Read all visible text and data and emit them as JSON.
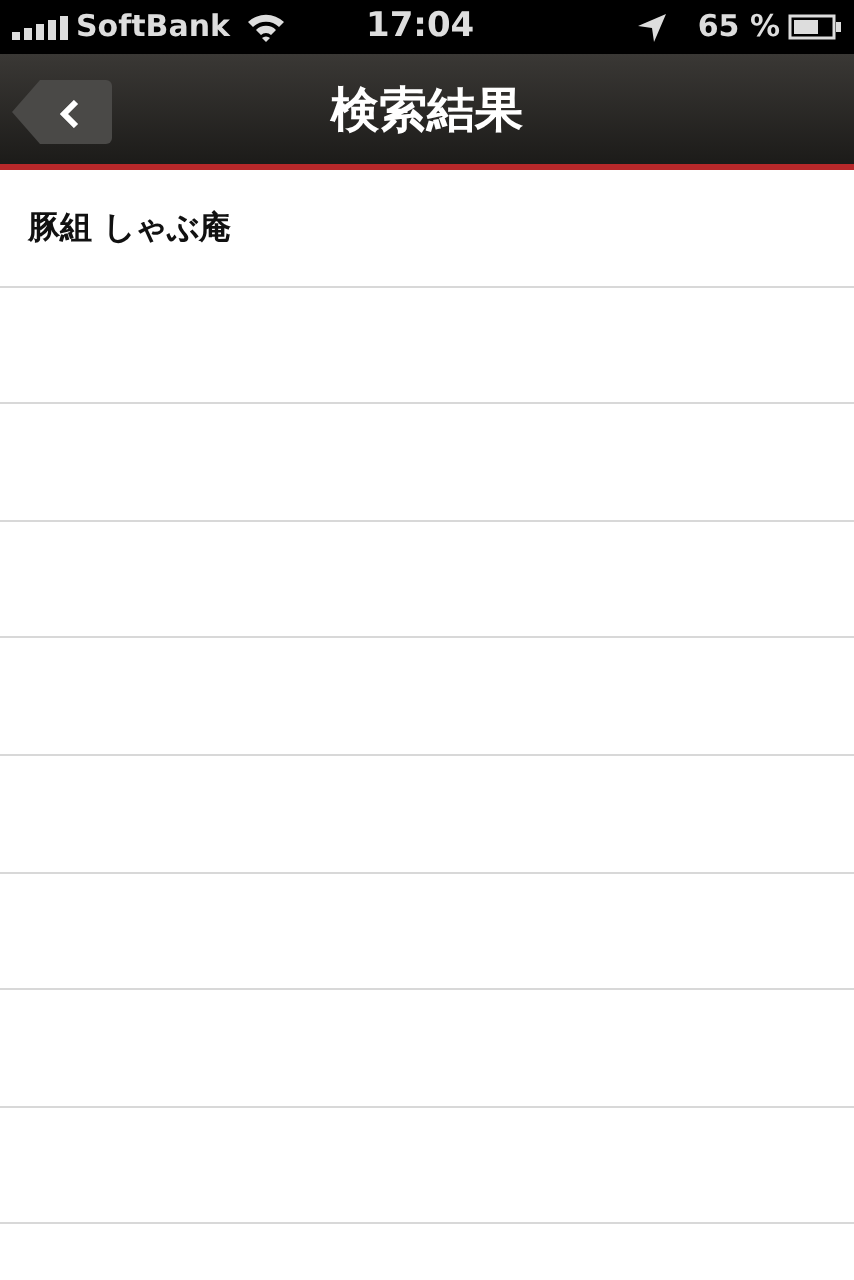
{
  "status_bar": {
    "carrier": "SoftBank",
    "time": "17:04",
    "battery": "65 %"
  },
  "nav_bar": {
    "title": "検索結果"
  },
  "results": [
    {
      "name": "豚組 しゃぶ庵"
    }
  ]
}
